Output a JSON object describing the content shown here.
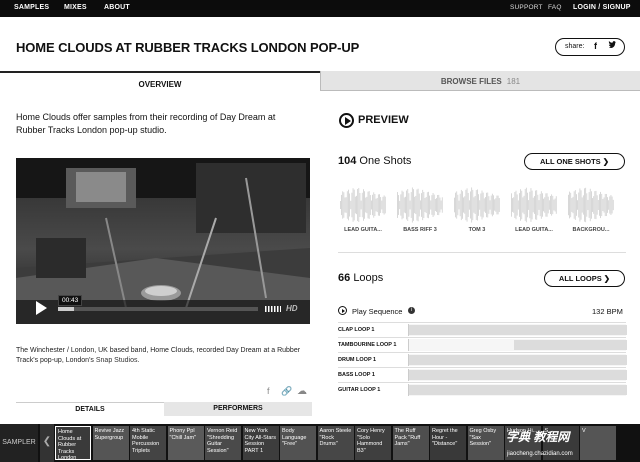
{
  "nav": {
    "samples": "SAMPLES",
    "mixes": "MIXES",
    "about": "ABOUT",
    "support": "SUPPORT",
    "faq": "FAQ",
    "login": "LOGIN / SIGNUP"
  },
  "header": {
    "title": "HOME CLOUDS AT RUBBER TRACKS LONDON POP-UP",
    "share_label": "share:",
    "share_icons": [
      "facebook-icon",
      "twitter-icon"
    ]
  },
  "tabs": {
    "overview": "OVERVIEW",
    "browse_files": "BROWSE FILES",
    "browse_count": "181"
  },
  "description": "Home Clouds offer samples from their recording of Day Dream at Rubber Tracks London pop-up studio.",
  "video": {
    "time": "00:43",
    "progress": 0.08,
    "hd": "HD"
  },
  "caption": {
    "text": "The Winchester / London, UK based band, Home Clouds, recorded Day Dream at a Rubber Track's pop-up, London's ",
    "link": "Snap Studios",
    "end": "."
  },
  "subtabs": {
    "details": "DETAILS",
    "performers": "PERFORMERS"
  },
  "preview": {
    "label": "PREVIEW"
  },
  "one_shots": {
    "count": "104",
    "label": "One Shots",
    "button": "ALL ONE SHOTS ❯",
    "items": [
      "LEAD GUITA...",
      "BASS RIFF 3",
      "TOM 3",
      "LEAD GUITA...",
      "BACKGROU..."
    ]
  },
  "loops": {
    "count": "66",
    "label": "Loops",
    "button": "ALL LOOPS ❯",
    "play_sequence": "Play Sequence",
    "info": "i",
    "bpm": "132 BPM",
    "rows": [
      {
        "name": "CLAP LOOP 1"
      },
      {
        "name": "TAMBOURINE LOOP 1"
      },
      {
        "name": "DRUM LOOP 1"
      },
      {
        "name": "BASS LOOP 1"
      },
      {
        "name": "GUITAR LOOP 1"
      }
    ]
  },
  "strip": {
    "sampler": "SAMPLER",
    "prev": "❮",
    "items": [
      "Home Clouds at Rubber Tracks London",
      "Revive Jazz Supergroup",
      "4th Static Mobile Percussion Triplets",
      "Phony Ppl \"Chill Jam\"",
      "Vernon Reid \"Shredding Guitar Session\"",
      "New York City All-Stars Session PART 1",
      "Body Language \"Free\"",
      "Aaron Steele \"Rock Drums\"",
      "Cory Henry \"Solo Hammond B3\"",
      "The Ruff Pack \"Ruff Jams\"",
      "Regret the Hour - \"Distance\"",
      "Greg Osby \"Sax Session\"",
      "Hudson Hi...",
      "S",
      "V"
    ],
    "watermark": "字典 教程网",
    "watermark_url": "jiaocheng.chazidian.com"
  }
}
